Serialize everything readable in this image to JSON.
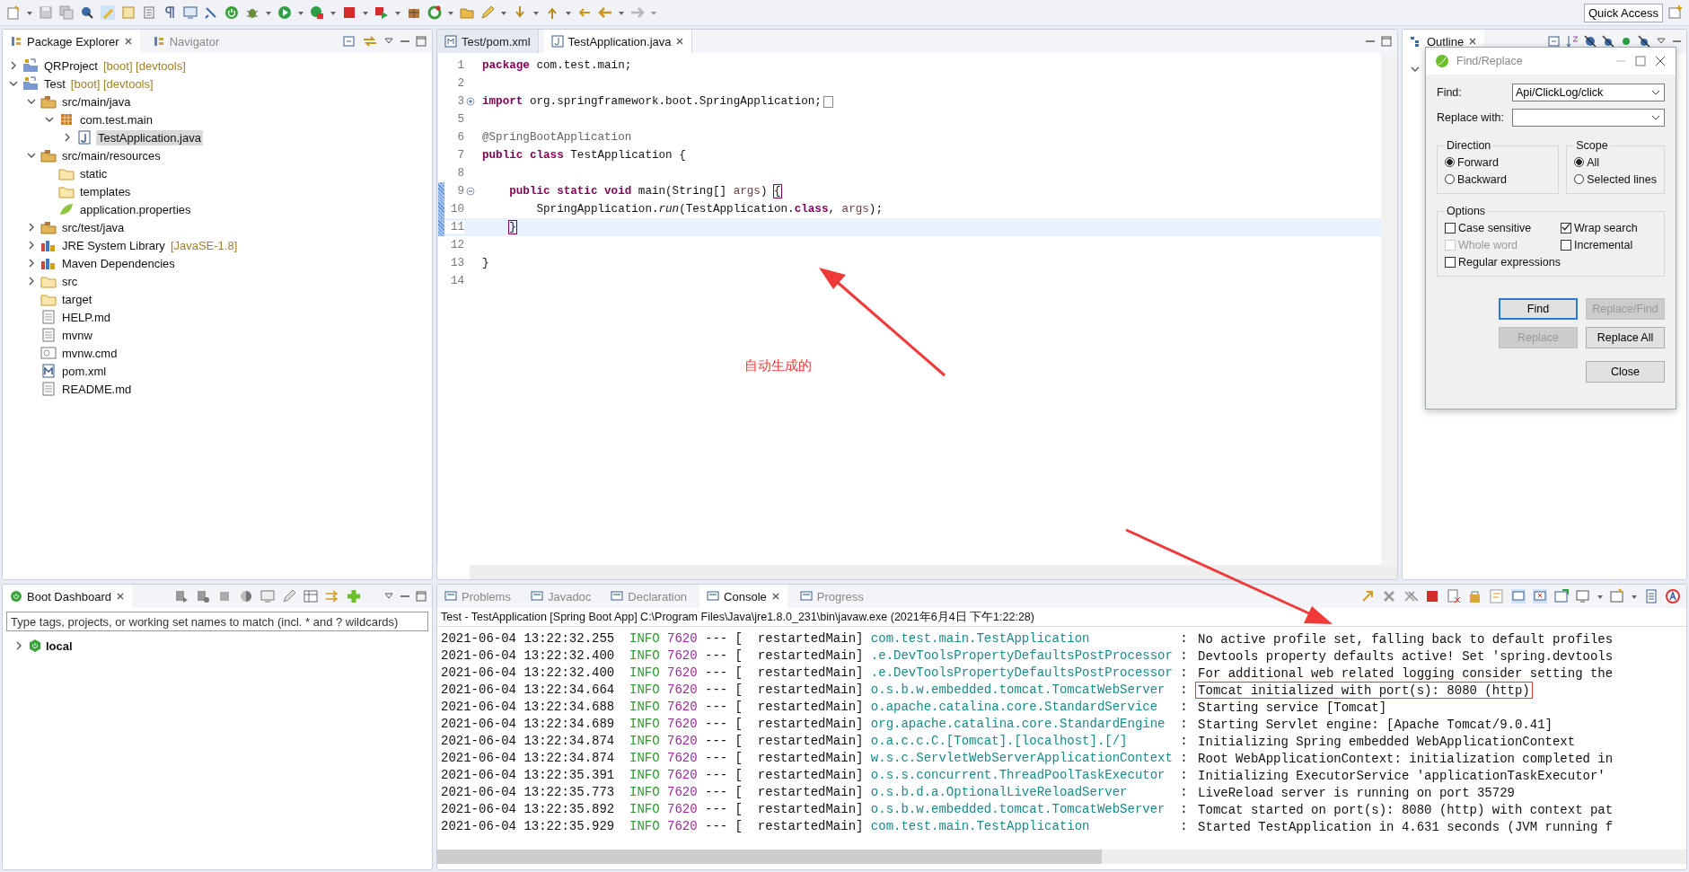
{
  "toolbar": {
    "quick_access": "Quick Access"
  },
  "package_explorer": {
    "tabs": [
      {
        "label": "Package Explorer",
        "selected": true
      },
      {
        "label": "Navigator",
        "selected": false
      }
    ],
    "items": [
      {
        "label": "QRProject",
        "decoration": "[boot] [devtools]",
        "kind": "project",
        "expanded": false,
        "selected": false
      },
      {
        "label": "Test",
        "decoration": "[boot] [devtools]",
        "kind": "project",
        "expanded": true,
        "selected": false,
        "children": [
          {
            "label": "src/main/java",
            "kind": "source-folder",
            "expanded": true,
            "selected": false,
            "children": [
              {
                "label": "com.test.main",
                "kind": "package",
                "expanded": true,
                "selected": false,
                "children": [
                  {
                    "label": "TestApplication.java",
                    "kind": "java-file",
                    "expanded": false,
                    "selected": true
                  }
                ]
              }
            ]
          },
          {
            "label": "src/main/resources",
            "kind": "source-folder",
            "expanded": true,
            "selected": false,
            "children": [
              {
                "label": "static",
                "kind": "folder",
                "selected": false
              },
              {
                "label": "templates",
                "kind": "folder",
                "selected": false
              },
              {
                "label": "application.properties",
                "kind": "properties",
                "selected": false
              }
            ]
          },
          {
            "label": "src/test/java",
            "kind": "source-folder",
            "expanded": false,
            "selected": false
          },
          {
            "label": "JRE System Library",
            "decoration": "[JavaSE-1.8]",
            "kind": "library",
            "expanded": false,
            "selected": false
          },
          {
            "label": "Maven Dependencies",
            "kind": "library",
            "expanded": false,
            "selected": false
          },
          {
            "label": "src",
            "kind": "folder",
            "expanded": false,
            "selected": false
          },
          {
            "label": "target",
            "kind": "folder",
            "selected": false
          },
          {
            "label": "HELP.md",
            "kind": "file",
            "selected": false
          },
          {
            "label": "mvnw",
            "kind": "file",
            "selected": false
          },
          {
            "label": "mvnw.cmd",
            "kind": "cmd-file",
            "selected": false
          },
          {
            "label": "pom.xml",
            "kind": "maven-file",
            "selected": false
          },
          {
            "label": "README.md",
            "kind": "file",
            "selected": false
          }
        ]
      }
    ]
  },
  "editor": {
    "tabs": [
      {
        "label": "Test/pom.xml",
        "selected": false
      },
      {
        "label": "TestApplication.java",
        "selected": true
      }
    ],
    "lines": [
      {
        "number": "1",
        "tokens": [
          {
            "text": "package",
            "kind": "keyword"
          },
          {
            "text": " com.test.main;",
            "kind": "plain"
          }
        ]
      },
      {
        "number": "2"
      },
      {
        "number": "3",
        "folded": true,
        "tokens": [
          {
            "text": "import",
            "kind": "keyword"
          },
          {
            "text": " org.springframework.boot.SpringApplication;",
            "kind": "plain"
          }
        ]
      },
      {
        "number": "5"
      },
      {
        "number": "6",
        "tokens": [
          {
            "text": "@SpringBootApplication",
            "kind": "annotation"
          }
        ]
      },
      {
        "number": "7",
        "tokens": [
          {
            "text": "public class",
            "kind": "keyword"
          },
          {
            "text": " TestApplication {",
            "kind": "plain"
          }
        ]
      },
      {
        "number": "8"
      },
      {
        "number": "9",
        "folded": false,
        "changed": true,
        "tokens": [
          {
            "text": "    public static void",
            "kind": "keyword"
          },
          {
            "text": " main(String[] ",
            "kind": "plain"
          },
          {
            "text": "args",
            "kind": "variable"
          },
          {
            "text": ") ",
            "kind": "plain"
          },
          {
            "text": "{",
            "kind": "bracket"
          }
        ]
      },
      {
        "number": "10",
        "changed": true,
        "tokens": [
          {
            "text": "        SpringApplication.",
            "kind": "plain"
          },
          {
            "text": "run",
            "kind": "italic"
          },
          {
            "text": "(TestApplication.",
            "kind": "plain"
          },
          {
            "text": "class",
            "kind": "keyword"
          },
          {
            "text": ", ",
            "kind": "plain"
          },
          {
            "text": "args",
            "kind": "variable"
          },
          {
            "text": ");",
            "kind": "plain"
          }
        ]
      },
      {
        "number": "11",
        "changed": true,
        "current": true,
        "tokens": [
          {
            "text": "}",
            "kind": "indented-bracket"
          }
        ]
      },
      {
        "number": "12"
      },
      {
        "number": "13",
        "tokens": [
          {
            "text": "}",
            "kind": "plain"
          }
        ]
      },
      {
        "number": "14"
      }
    ]
  },
  "annotation": {
    "text": "自动生成的"
  },
  "outline": {
    "tabs": [
      {
        "label": "Outline",
        "selected": true
      }
    ]
  },
  "find_replace": {
    "title": "Find/Replace",
    "find_label": "Find:",
    "find_value": "Api/ClickLog/click",
    "replace_label": "Replace with:",
    "direction": {
      "title": "Direction",
      "options": [
        {
          "label": "Forward",
          "selected": true
        },
        {
          "label": "Backward",
          "selected": false
        }
      ]
    },
    "scope": {
      "title": "Scope",
      "options": [
        {
          "label": "All",
          "selected": true
        },
        {
          "label": "Selected lines",
          "selected": false
        }
      ]
    },
    "options": {
      "title": "Options",
      "items": [
        {
          "label": "Case sensitive",
          "checked": false,
          "disabled": false
        },
        {
          "label": "Wrap search",
          "checked": true,
          "disabled": false
        },
        {
          "label": "Whole word",
          "checked": false,
          "disabled": true
        },
        {
          "label": "Incremental",
          "checked": false,
          "disabled": false
        },
        {
          "label": "Regular expressions",
          "checked": false,
          "disabled": false
        }
      ]
    },
    "buttons": [
      {
        "label": "Find",
        "disabled": false,
        "default": true
      },
      {
        "label": "Replace/Find",
        "disabled": true,
        "default": false
      },
      {
        "label": "Replace",
        "disabled": true,
        "default": false
      },
      {
        "label": "Replace All",
        "disabled": false,
        "default": false
      },
      {
        "label": "Close",
        "disabled": false,
        "default": false
      }
    ]
  },
  "boot_dashboard": {
    "tabs": [
      {
        "label": "Boot Dashboard",
        "selected": true
      }
    ],
    "filter": {
      "placeholder": "Type tags, projects, or working set names to match (incl. * and ? wildcards)"
    },
    "items": [
      {
        "label": "local",
        "expanded": false
      }
    ]
  },
  "console": {
    "tabs": [
      {
        "label": "Problems",
        "selected": false
      },
      {
        "label": "Javadoc",
        "selected": false
      },
      {
        "label": "Declaration",
        "selected": false
      },
      {
        "label": "Console",
        "selected": true
      },
      {
        "label": "Progress",
        "selected": false
      }
    ],
    "header": "Test - TestApplication [Spring Boot App] C:\\Program Files\\Java\\jre1.8.0_231\\bin\\javaw.exe (2021年6月4日 下午1:22:28)",
    "rows": [
      {
        "time": "2021-06-04 13:22:32.255",
        "level": "INFO",
        "pid": "7620",
        "thread": "--- [  restartedMain]",
        "logger": "com.test.main.TestApplication",
        "sep": ":",
        "message": "No active profile set, falling back to default profiles",
        "boxed": false
      },
      {
        "time": "2021-06-04 13:22:32.400",
        "level": "INFO",
        "pid": "7620",
        "thread": "--- [  restartedMain]",
        "logger": ".e.DevToolsPropertyDefaultsPostProcessor",
        "sep": ":",
        "message": "Devtools property defaults active! Set 'spring.devtools",
        "boxed": false
      },
      {
        "time": "2021-06-04 13:22:32.400",
        "level": "INFO",
        "pid": "7620",
        "thread": "--- [  restartedMain]",
        "logger": ".e.DevToolsPropertyDefaultsPostProcessor",
        "sep": ":",
        "message": "For additional web related logging consider setting the",
        "boxed": false
      },
      {
        "time": "2021-06-04 13:22:34.664",
        "level": "INFO",
        "pid": "7620",
        "thread": "--- [  restartedMain]",
        "logger": "o.s.b.w.embedded.tomcat.TomcatWebServer",
        "sep": ":",
        "message": "Tomcat initialized with port(s): 8080 (http)",
        "boxed": true
      },
      {
        "time": "2021-06-04 13:22:34.688",
        "level": "INFO",
        "pid": "7620",
        "thread": "--- [  restartedMain]",
        "logger": "o.apache.catalina.core.StandardService",
        "sep": ":",
        "message": "Starting service [Tomcat]",
        "boxed": false
      },
      {
        "time": "2021-06-04 13:22:34.689",
        "level": "INFO",
        "pid": "7620",
        "thread": "--- [  restartedMain]",
        "logger": "org.apache.catalina.core.StandardEngine",
        "sep": ":",
        "message": "Starting Servlet engine: [Apache Tomcat/9.0.41]",
        "boxed": false
      },
      {
        "time": "2021-06-04 13:22:34.874",
        "level": "INFO",
        "pid": "7620",
        "thread": "--- [  restartedMain]",
        "logger": "o.a.c.c.C.[Tomcat].[localhost].[/]",
        "sep": ":",
        "message": "Initializing Spring embedded WebApplicationContext",
        "boxed": false
      },
      {
        "time": "2021-06-04 13:22:34.874",
        "level": "INFO",
        "pid": "7620",
        "thread": "--- [  restartedMain]",
        "logger": "w.s.c.ServletWebServerApplicationContext",
        "sep": ":",
        "message": "Root WebApplicationContext: initialization completed in",
        "boxed": false
      },
      {
        "time": "2021-06-04 13:22:35.391",
        "level": "INFO",
        "pid": "7620",
        "thread": "--- [  restartedMain]",
        "logger": "o.s.s.concurrent.ThreadPoolTaskExecutor",
        "sep": ":",
        "message": "Initializing ExecutorService 'applicationTaskExecutor'",
        "boxed": false
      },
      {
        "time": "2021-06-04 13:22:35.773",
        "level": "INFO",
        "pid": "7620",
        "thread": "--- [  restartedMain]",
        "logger": "o.s.b.d.a.OptionalLiveReloadServer",
        "sep": ":",
        "message": "LiveReload server is running on port 35729",
        "boxed": false
      },
      {
        "time": "2021-06-04 13:22:35.892",
        "level": "INFO",
        "pid": "7620",
        "thread": "--- [  restartedMain]",
        "logger": "o.s.b.w.embedded.tomcat.TomcatWebServer",
        "sep": ":",
        "message": "Tomcat started on port(s): 8080 (http) with context pat",
        "boxed": false
      },
      {
        "time": "2021-06-04 13:22:35.929",
        "level": "INFO",
        "pid": "7620",
        "thread": "--- [  restartedMain]",
        "logger": "com.test.main.TestApplication",
        "sep": ":",
        "message": "Started TestApplication in 4.631 seconds (JVM running f",
        "boxed": false
      }
    ]
  }
}
